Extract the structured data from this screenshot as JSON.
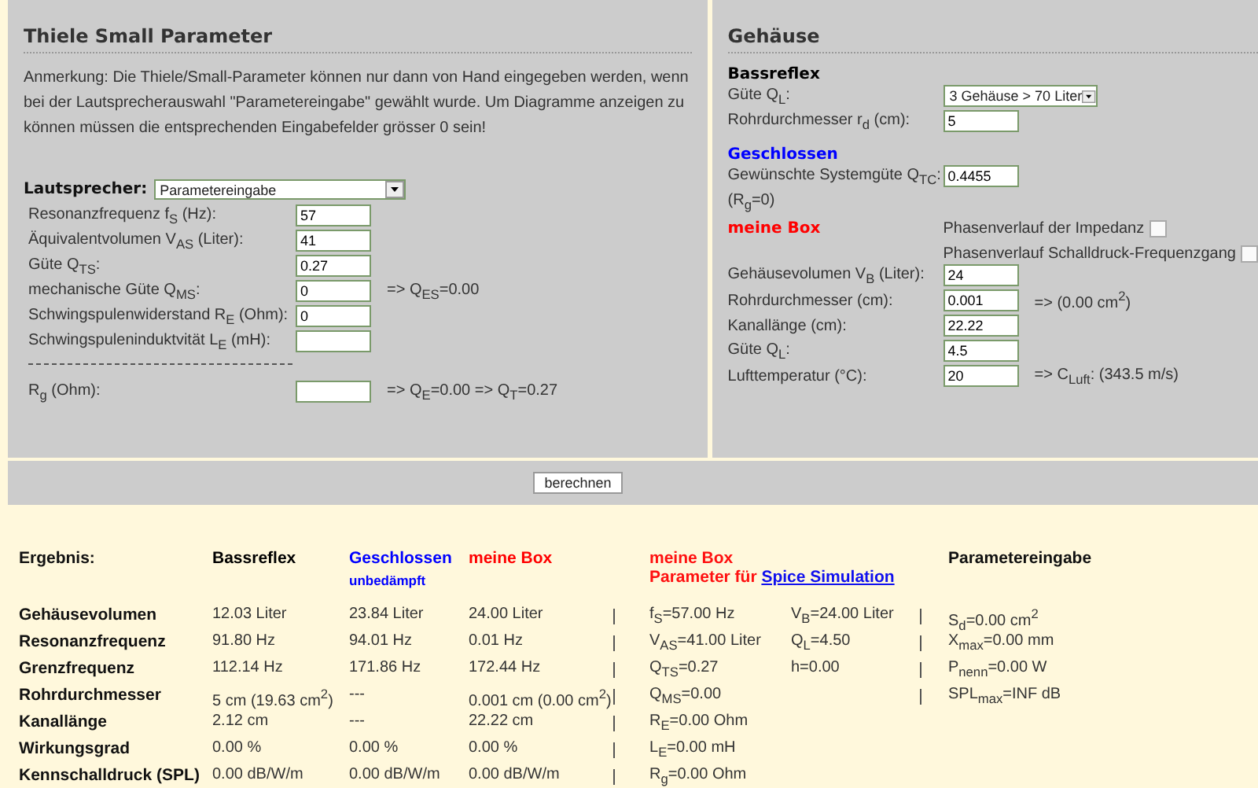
{
  "thiele_small": {
    "title": "Thiele Small Parameter",
    "note": "Anmerkung: Die Thiele/Small-Parameter können nur dann von Hand eingegeben werden, wenn bei der Lautsprecherauswahl \"Parametereingabe\" gewählt wurde. Um Diagramme anzeigen zu können müssen die entsprechenden Eingabefelder grösser 0 sein!",
    "speaker": {
      "label": "Lautsprecher:",
      "value": "Parametereingabe"
    },
    "fields": [
      {
        "label": "Resonanzfrequenz f$_{S}$ (Hz):",
        "value": "57"
      },
      {
        "label": "Äquivalentvolumen V$_{AS}$ (Liter):",
        "value": "41"
      },
      {
        "label": "Güte Q$_{TS}$:",
        "value": "0.27"
      },
      {
        "label": "mechanische Güte Q$_{MS}$:",
        "value": "0",
        "result": "=> Q$_{ES}$=0.00"
      },
      {
        "label": "Schwingspulenwiderstand R$_{E}$ (Ohm):",
        "value": "0"
      },
      {
        "label": "Schwingspuleninduktvität L$_{E}$ (mH):"
      }
    ],
    "rg": {
      "label": "R$_{g}$ (Ohm):",
      "result": "=> Q$_{E}$=0.00 => Q$_{T}$=0.27"
    }
  },
  "gehaeuse": {
    "title": "Gehäuse",
    "bassreflex": {
      "heading": "Bassreflex",
      "color": "#000000",
      "select": {
        "label": "Güte Q$_{L}$:",
        "value": "3 Gehäuse > 70 Liter"
      },
      "field": {
        "label": "Rohrdurchmesser r$_{d}$ (cm):",
        "value": "5"
      }
    },
    "geschlossen": {
      "heading": "Geschlossen",
      "color": "#0000ff",
      "field": {
        "label": "Gewünschte Systemgüte Q$_{TC}$:",
        "value": "0.4455"
      },
      "note": "(R$_{g}$=0)"
    },
    "meine_box": {
      "heading": "meine Box",
      "color": "#ff0000",
      "checkboxes": [
        {
          "label": "Phasenverlauf der Impedanz",
          "checked": false
        },
        {
          "label": "Phasenverlauf Schalldruck-Frequenzgang",
          "checked": false
        }
      ],
      "fields": [
        {
          "label": "Gehäusevolumen V$_{B}$ (Liter):",
          "value": "24"
        },
        {
          "label": "Rohrdurchmesser (cm):",
          "value": "0.001",
          "result": "=> (0.00 cm$^{2}$)"
        },
        {
          "label": "Kanallänge (cm):",
          "value": "22.22"
        },
        {
          "label": "Güte Q$_{L}$:",
          "value": "4.5"
        },
        {
          "label": "Lufttemperatur (°C):",
          "value": "20",
          "result": "=> C$_{Luft}$: (343.5 m/s)"
        }
      ]
    }
  },
  "button": "berechnen",
  "results": {
    "title": "Ergebnis:",
    "columns": [
      {
        "name": "Bassreflex",
        "color": "#000000"
      },
      {
        "name": "Geschlossen",
        "sub": "unbedämpft",
        "color": "#0000ff"
      },
      {
        "name": "meine Box",
        "color": "#ff0000"
      }
    ],
    "rows": [
      {
        "label": "Gehäusevolumen",
        "values": [
          "12.03 Liter",
          "23.84 Liter",
          "24.00 Liter"
        ]
      },
      {
        "label": "Resonanzfrequenz",
        "values": [
          "91.80 Hz",
          "94.01 Hz",
          "0.01 Hz"
        ]
      },
      {
        "label": "Grenzfrequenz",
        "values": [
          "112.14 Hz",
          "171.86 Hz",
          "172.44 Hz"
        ]
      },
      {
        "label": "Rohrdurchmesser",
        "values": [
          "5 cm (19.63 cm$^{2}$)",
          "---",
          "0.001 cm (0.00 cm$^{2}$)"
        ]
      },
      {
        "label": "Kanallänge",
        "values": [
          "2.12 cm",
          "---",
          "22.22 cm"
        ]
      },
      {
        "label": "Wirkungsgrad",
        "values": [
          "0.00 %",
          "0.00 %",
          "0.00 %"
        ]
      },
      {
        "label": "Kennschalldruck (SPL)",
        "values": [
          "0.00 dB/W/m",
          "0.00 dB/W/m",
          "0.00 dB/W/m"
        ]
      }
    ],
    "spice": {
      "heading": "meine Box",
      "prefix": "Parameter für",
      "link": "Spice Simulation",
      "column_1": [
        "f$_{S}$=57.00 Hz",
        "V$_{AS}$=41.00 Liter",
        "Q$_{TS}$=0.27",
        "Q$_{MS}$=0.00",
        "R$_{E}$=0.00 Ohm",
        "L$_{E}$=0.00 mH",
        "R$_{g}$=0.00 Ohm"
      ],
      "column_2": [
        "V$_{B}$=24.00 Liter",
        "Q$_{L}$=4.50",
        "h=0.00"
      ]
    },
    "parameters": {
      "heading": "Parametereingabe",
      "lines": [
        "S$_{d}$=0.00 cm$^{2}$",
        "X$_{max}$=0.00 mm",
        "P$_{nenn}$=0.00 W",
        "SPL$_{max}$=INF dB"
      ]
    }
  }
}
